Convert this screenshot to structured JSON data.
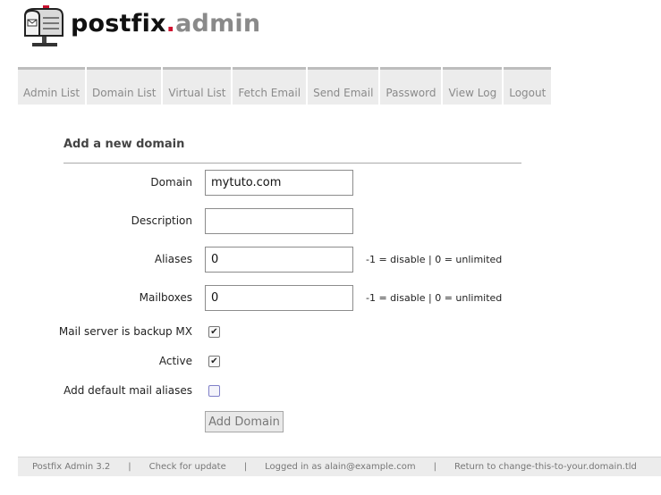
{
  "header": {
    "logo_main": "postfix",
    "logo_dot": ".",
    "logo_suffix": "admin",
    "logo_icon": "mailbox-icon"
  },
  "menu": [
    {
      "label": "Admin List"
    },
    {
      "label": "Domain List"
    },
    {
      "label": "Virtual List"
    },
    {
      "label": "Fetch Email"
    },
    {
      "label": "Send Email"
    },
    {
      "label": "Password"
    },
    {
      "label": "View Log"
    },
    {
      "label": "Logout"
    }
  ],
  "form": {
    "title": "Add a new domain",
    "domain": {
      "label": "Domain",
      "value": "mytuto.com"
    },
    "description": {
      "label": "Description",
      "value": ""
    },
    "aliases": {
      "label": "Aliases",
      "value": "0",
      "hint": "-1 = disable | 0 = unlimited"
    },
    "mailboxes": {
      "label": "Mailboxes",
      "value": "0",
      "hint": "-1 = disable | 0 = unlimited"
    },
    "backup_mx": {
      "label": "Mail server is backup MX",
      "checked": true
    },
    "active": {
      "label": "Active",
      "checked": true
    },
    "default_aliases": {
      "label": "Add default mail aliases",
      "checked": false
    },
    "submit_label": "Add Domain"
  },
  "footer": {
    "version": "Postfix Admin 3.2",
    "check_update": "Check for update",
    "logged_in": "Logged in as alain@example.com",
    "return_link": "Return to change-this-to-your.domain.tld",
    "separator": "|"
  },
  "colors": {
    "logo_dot": "#d0102e",
    "logo_suffix": "#8a8a8a",
    "menu_bg": "#ececec",
    "menu_top_border": "#bdbdbd",
    "footer_bg": "#ececec"
  }
}
